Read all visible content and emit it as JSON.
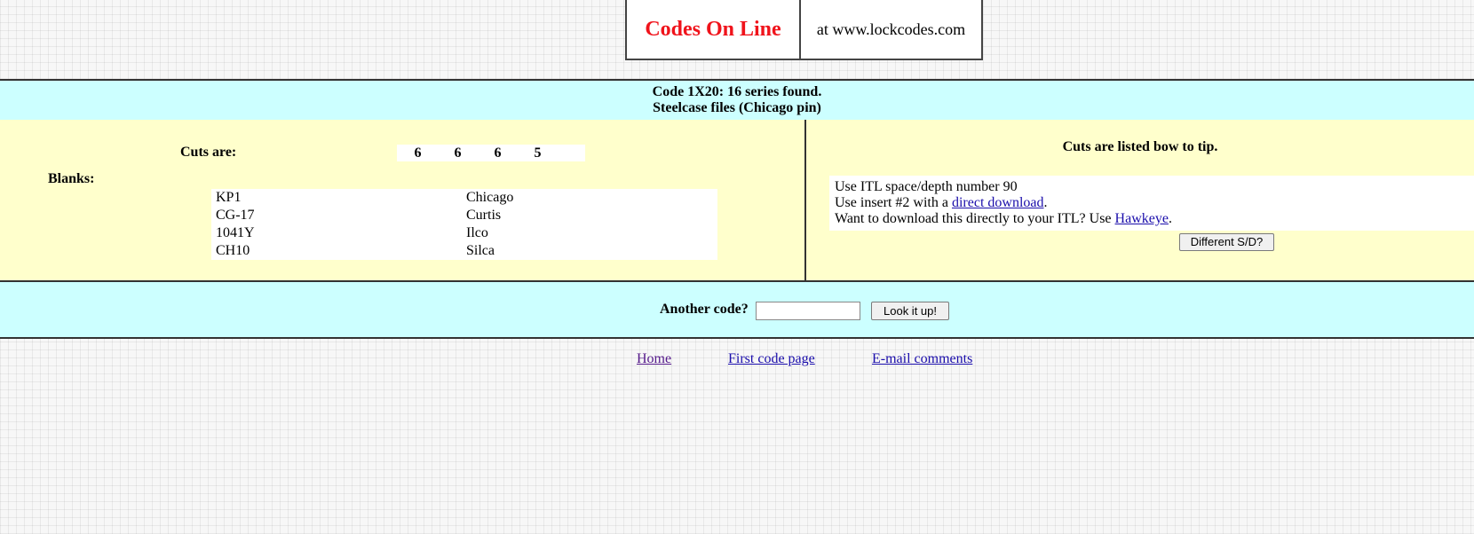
{
  "header": {
    "title": "Codes On Line",
    "site": "at www.lockcodes.com"
  },
  "result": {
    "line1": "Code 1X20: 16 series found.",
    "line2": "Steelcase files (Chicago pin)"
  },
  "cuts": {
    "label": "Cuts are:",
    "values": [
      "6",
      "6",
      "6",
      "5"
    ]
  },
  "blanks": {
    "label": "Blanks:",
    "rows": [
      {
        "code": "KP1",
        "maker": "Chicago"
      },
      {
        "code": "CG-17",
        "maker": "Curtis"
      },
      {
        "code": "1041Y",
        "maker": "Ilco"
      },
      {
        "code": "CH10",
        "maker": "Silca"
      }
    ]
  },
  "itl": {
    "bow_note": "Cuts are listed bow to tip.",
    "line1": "Use ITL space/depth number 90",
    "line2_prefix": "Use insert #2 with a ",
    "line2_link": "direct download",
    "line2_suffix": ".",
    "line3_prefix": "Want to download this directly to your ITL?  Use ",
    "line3_link": "Hawkeye",
    "line3_suffix": ".",
    "sd_button": "Different S/D?"
  },
  "lookup": {
    "label": "Another code?",
    "input_value": "",
    "button": "Look it up!"
  },
  "footer": {
    "home": "Home",
    "first_code_page": "First code page",
    "email": "E-mail comments"
  },
  "colors": {
    "title_red": "#f0131b",
    "band_cyan": "#ccffff",
    "panel_yellow": "#ffffcc",
    "link_blue": "#1a0dab",
    "visited_purple": "#551a8b"
  }
}
